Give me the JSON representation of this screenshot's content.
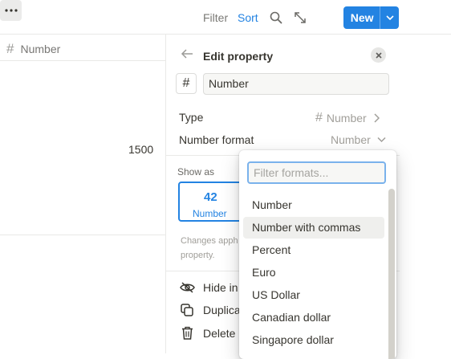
{
  "toolbar": {
    "filter_label": "Filter",
    "sort_label": "Sort",
    "new_label": "New"
  },
  "table": {
    "column_header": "Number",
    "cell_value": "1500"
  },
  "panel": {
    "title": "Edit property",
    "property_icon": "#",
    "property_name": "Number",
    "type_label": "Type",
    "type_value": "Number",
    "format_label": "Number format",
    "format_value": "Number",
    "show_as_label": "Show as",
    "card_number": "42",
    "card_label": "Number",
    "help_text_line1": "Changes apph",
    "help_text_line2": "property.",
    "actions": {
      "hide": "Hide in",
      "duplicate": "Duplica",
      "delete": "Delete"
    }
  },
  "dropdown": {
    "placeholder": "Filter formats...",
    "options": [
      "Number",
      "Number with commas",
      "Percent",
      "Euro",
      "US Dollar",
      "Canadian dollar",
      "Singapore dollar"
    ],
    "highlighted_index": 1
  },
  "colors": {
    "accent": "#2383e2",
    "text": "#37352f",
    "muted": "#a19f9a",
    "highlight": "#efefed"
  }
}
